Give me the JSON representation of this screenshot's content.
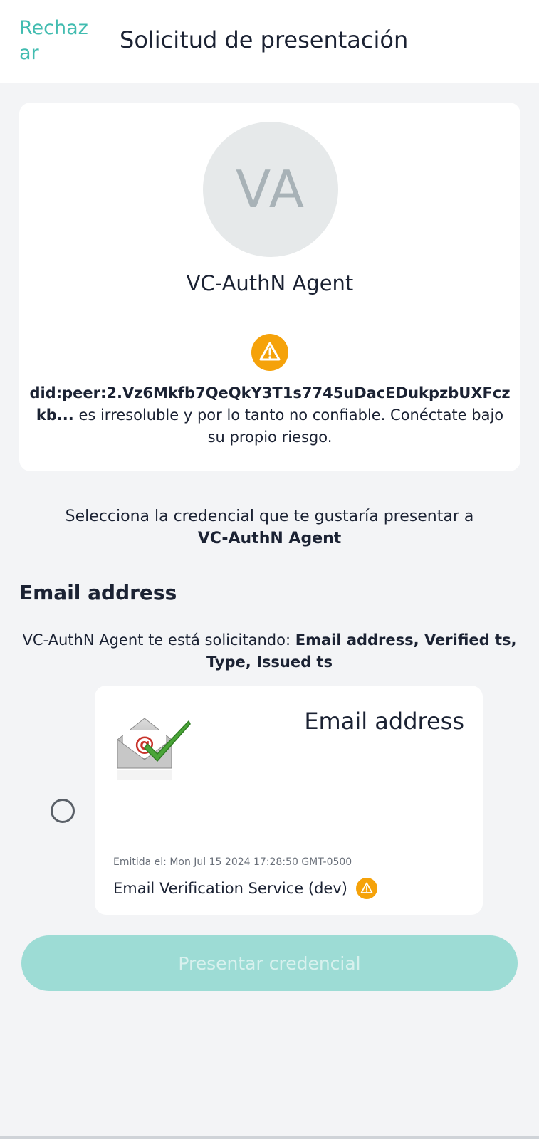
{
  "header": {
    "reject_label": "Rechazar",
    "title": "Solicitud de presentación"
  },
  "agent_card": {
    "avatar_initials": "VA",
    "name": "VC-AuthN Agent",
    "did_bold": "did:peer:2.Vz6Mkfb7QeQkY3T1s7745uDacEDukpzbUXFczkb...",
    "did_warning": " es irresoluble y por lo tanto no confiable. Conéctate bajo su propio riesgo."
  },
  "selection": {
    "prompt": "Selecciona la credencial que te gustaría presentar a",
    "agent_name": "VC-AuthN Agent"
  },
  "section": {
    "title": "Email address",
    "request_prefix": "VC-AuthN Agent te está solicitando: ",
    "request_attrs": "Email address, Verified ts, Type, Issued ts"
  },
  "credential": {
    "name": "Email address",
    "issued_on": "Emitida el: Mon Jul 15 2024 17:28:50 GMT-0500",
    "issuer": "Email Verification Service (dev)",
    "selected": false
  },
  "actions": {
    "present_label": "Presentar credencial",
    "enabled": false
  },
  "colors": {
    "accent": "#42bcb0",
    "warning": "#f5a20a",
    "button_disabled": "#9ddcd5"
  }
}
